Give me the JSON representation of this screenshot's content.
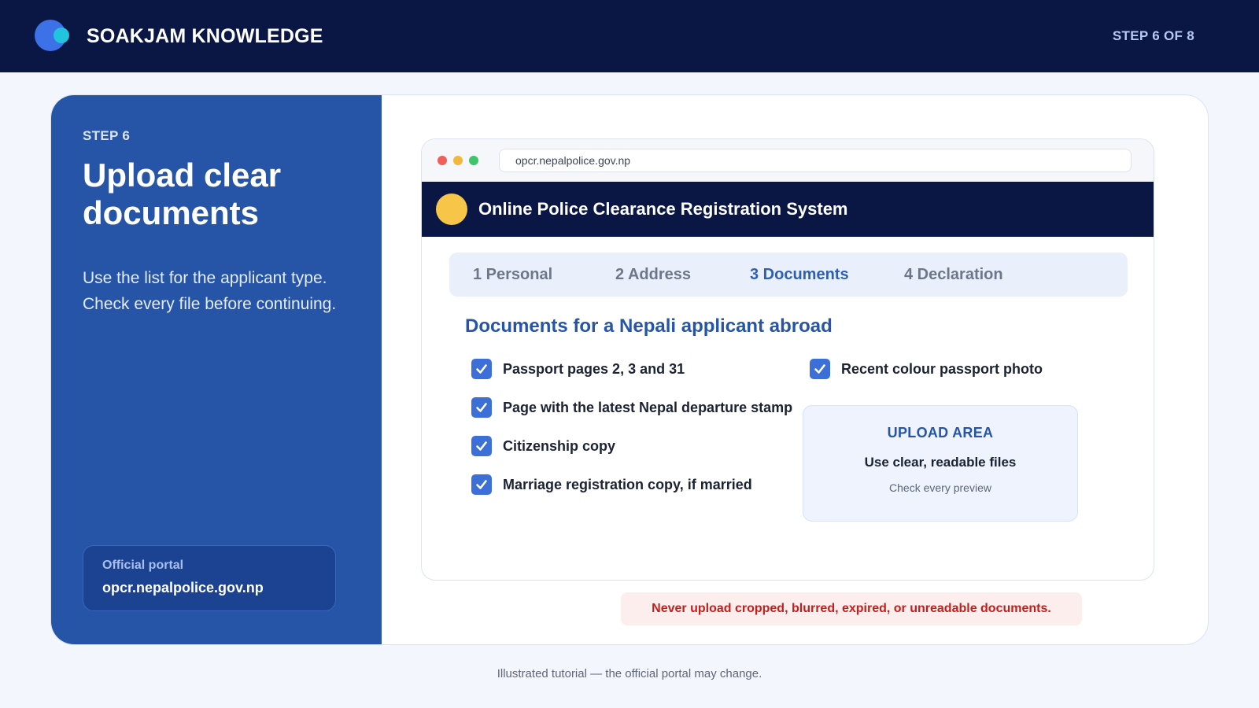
{
  "header": {
    "brand": "SOAKJAM KNOWLEDGE",
    "step_count": "STEP 6 OF 8"
  },
  "left_panel": {
    "step_label": "STEP 6",
    "title": "Upload clear documents",
    "description": "Use the list for the applicant type. Check every file before continuing.",
    "portal_label": "Official portal",
    "portal_url": "opcr.nepalpolice.gov.np"
  },
  "browser": {
    "url": "opcr.nepalpolice.gov.np",
    "site_title": "Online Police Clearance Registration System",
    "tabs": [
      {
        "label": "1 Personal",
        "active": false
      },
      {
        "label": "2 Address",
        "active": false
      },
      {
        "label": "3 Documents",
        "active": true
      },
      {
        "label": "4 Declaration",
        "active": false
      }
    ],
    "section_title": "Documents for a Nepali applicant abroad",
    "checklist": [
      {
        "label": "Passport pages 2, 3 and 31",
        "checked": true
      },
      {
        "label": "Page with the latest Nepal departure stamp",
        "checked": true
      },
      {
        "label": "Citizenship copy",
        "checked": true
      },
      {
        "label": "Marriage registration copy, if married",
        "checked": true
      },
      {
        "label": "Recent colour passport photo",
        "checked": true
      }
    ],
    "upload_area": {
      "title": "UPLOAD AREA",
      "subtitle": "Use clear, readable files",
      "hint": "Check every preview"
    }
  },
  "warning": "Never upload cropped, blurred, expired, or unreadable documents.",
  "footnote": "Illustrated tutorial — the official portal may change.",
  "icons": [
    "brand-logo-icon",
    "window-dots-icon",
    "site-emblem-icon",
    "checkmark-icon"
  ],
  "colors": {
    "header_bg": "#0a1745",
    "panel_bg": "#2655a8",
    "accent": "#3d6fd9",
    "warning": "#c0211e"
  }
}
